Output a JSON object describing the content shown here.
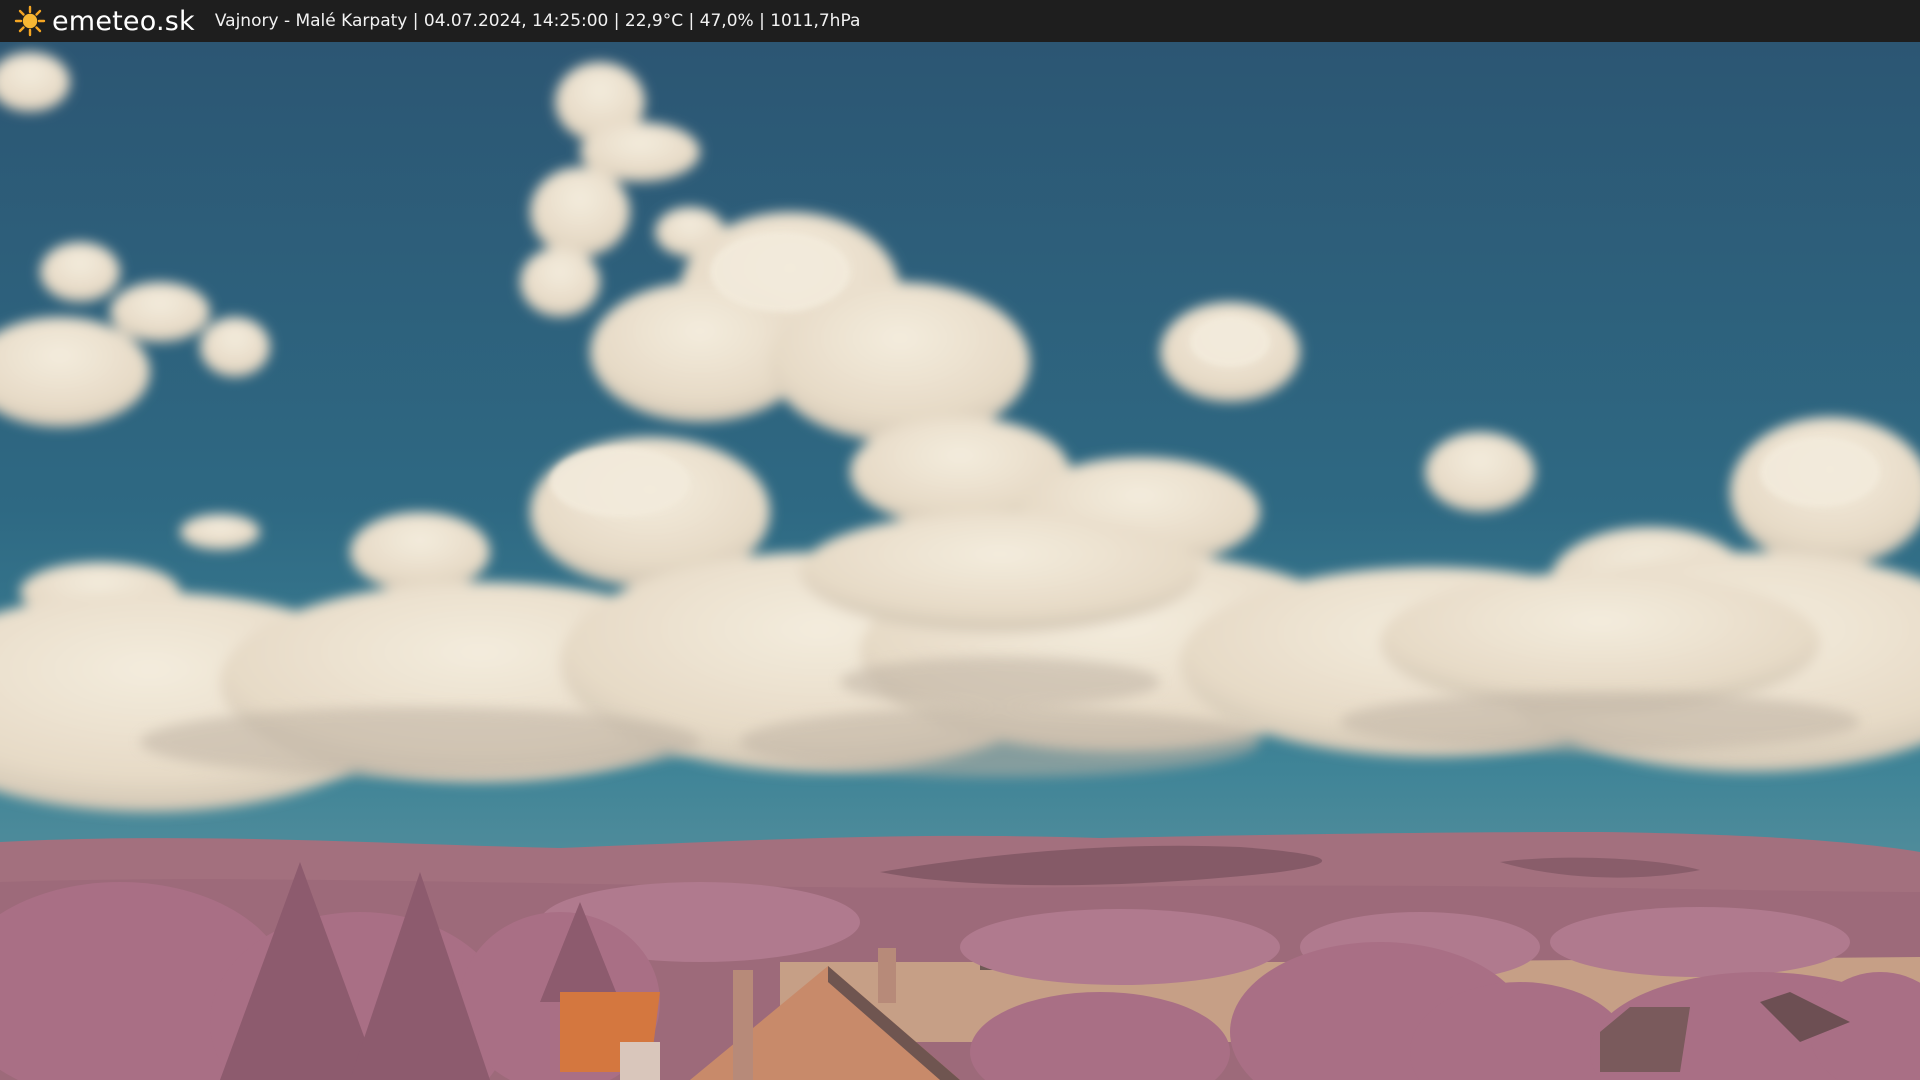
{
  "brand": {
    "icon": "sun-icon",
    "name": "emeteo.sk",
    "accent_color": "#f5a623"
  },
  "caption": {
    "text": "Vajnory - Malé Karpaty | 04.07.2024, 14:25:00 | 22,9°C | 47,0% | 1011,7hPa"
  },
  "scene": {
    "sky_color": "#2e6983",
    "cloud_color": "#ece2d1",
    "hill_color": "#a3707e",
    "tree_color": "#b07a8e",
    "field_color": "#c69f86",
    "roof_color": "#d4773f"
  }
}
